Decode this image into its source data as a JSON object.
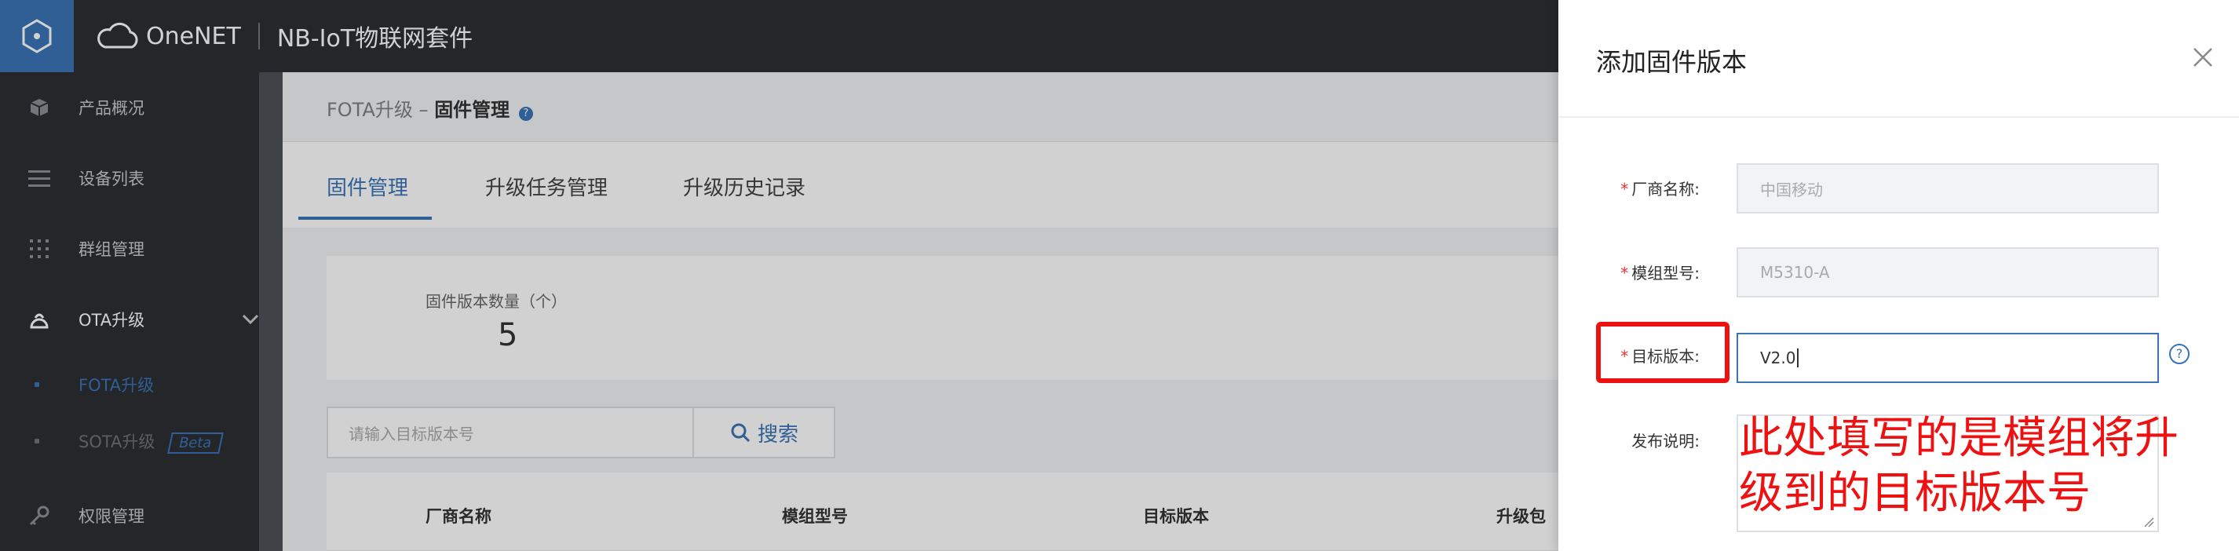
{
  "topbar": {
    "brand_name": "OneNET",
    "suite_name": "NB-IoT物联网套件"
  },
  "sidebar": {
    "items": [
      {
        "label": "产品概况",
        "icon": "cube-icon"
      },
      {
        "label": "设备列表",
        "icon": "list-icon"
      },
      {
        "label": "群组管理",
        "icon": "grid-icon"
      },
      {
        "label": "OTA升级",
        "icon": "ota-icon"
      },
      {
        "label": "权限管理",
        "icon": "key-icon"
      }
    ],
    "sub_items": [
      {
        "label": "FOTA升级",
        "active": true
      },
      {
        "label": "SOTA升级",
        "badge": "Beta"
      }
    ]
  },
  "main": {
    "breadcrumb_parent": "FOTA升级 –",
    "breadcrumb_current": "固件管理",
    "tabs": [
      "固件管理",
      "升级任务管理",
      "升级历史记录"
    ],
    "stat_label": "固件版本数量（个）",
    "stat_value": "5",
    "search_placeholder": "请输入目标版本号",
    "search_button": "搜索",
    "table_headers": [
      "厂商名称",
      "模组型号",
      "目标版本",
      "升级包"
    ]
  },
  "drawer": {
    "title": "添加固件版本",
    "fields": [
      {
        "label": "厂商名称:",
        "value": "中国移动",
        "required": true
      },
      {
        "label": "模组型号:",
        "value": "M5310-A",
        "required": true
      },
      {
        "label": "目标版本:",
        "value": "V2.0",
        "required": true
      }
    ],
    "release_notes_label": "发布说明:",
    "help_glyph": "?"
  },
  "annotation": {
    "text": "此处填写的是模组将升级到的目标版本号",
    "color": "#ee1111"
  },
  "colors": {
    "accent": "#3a74b6",
    "sidebar_bg": "#2c2f33",
    "required": "#ee3333"
  }
}
